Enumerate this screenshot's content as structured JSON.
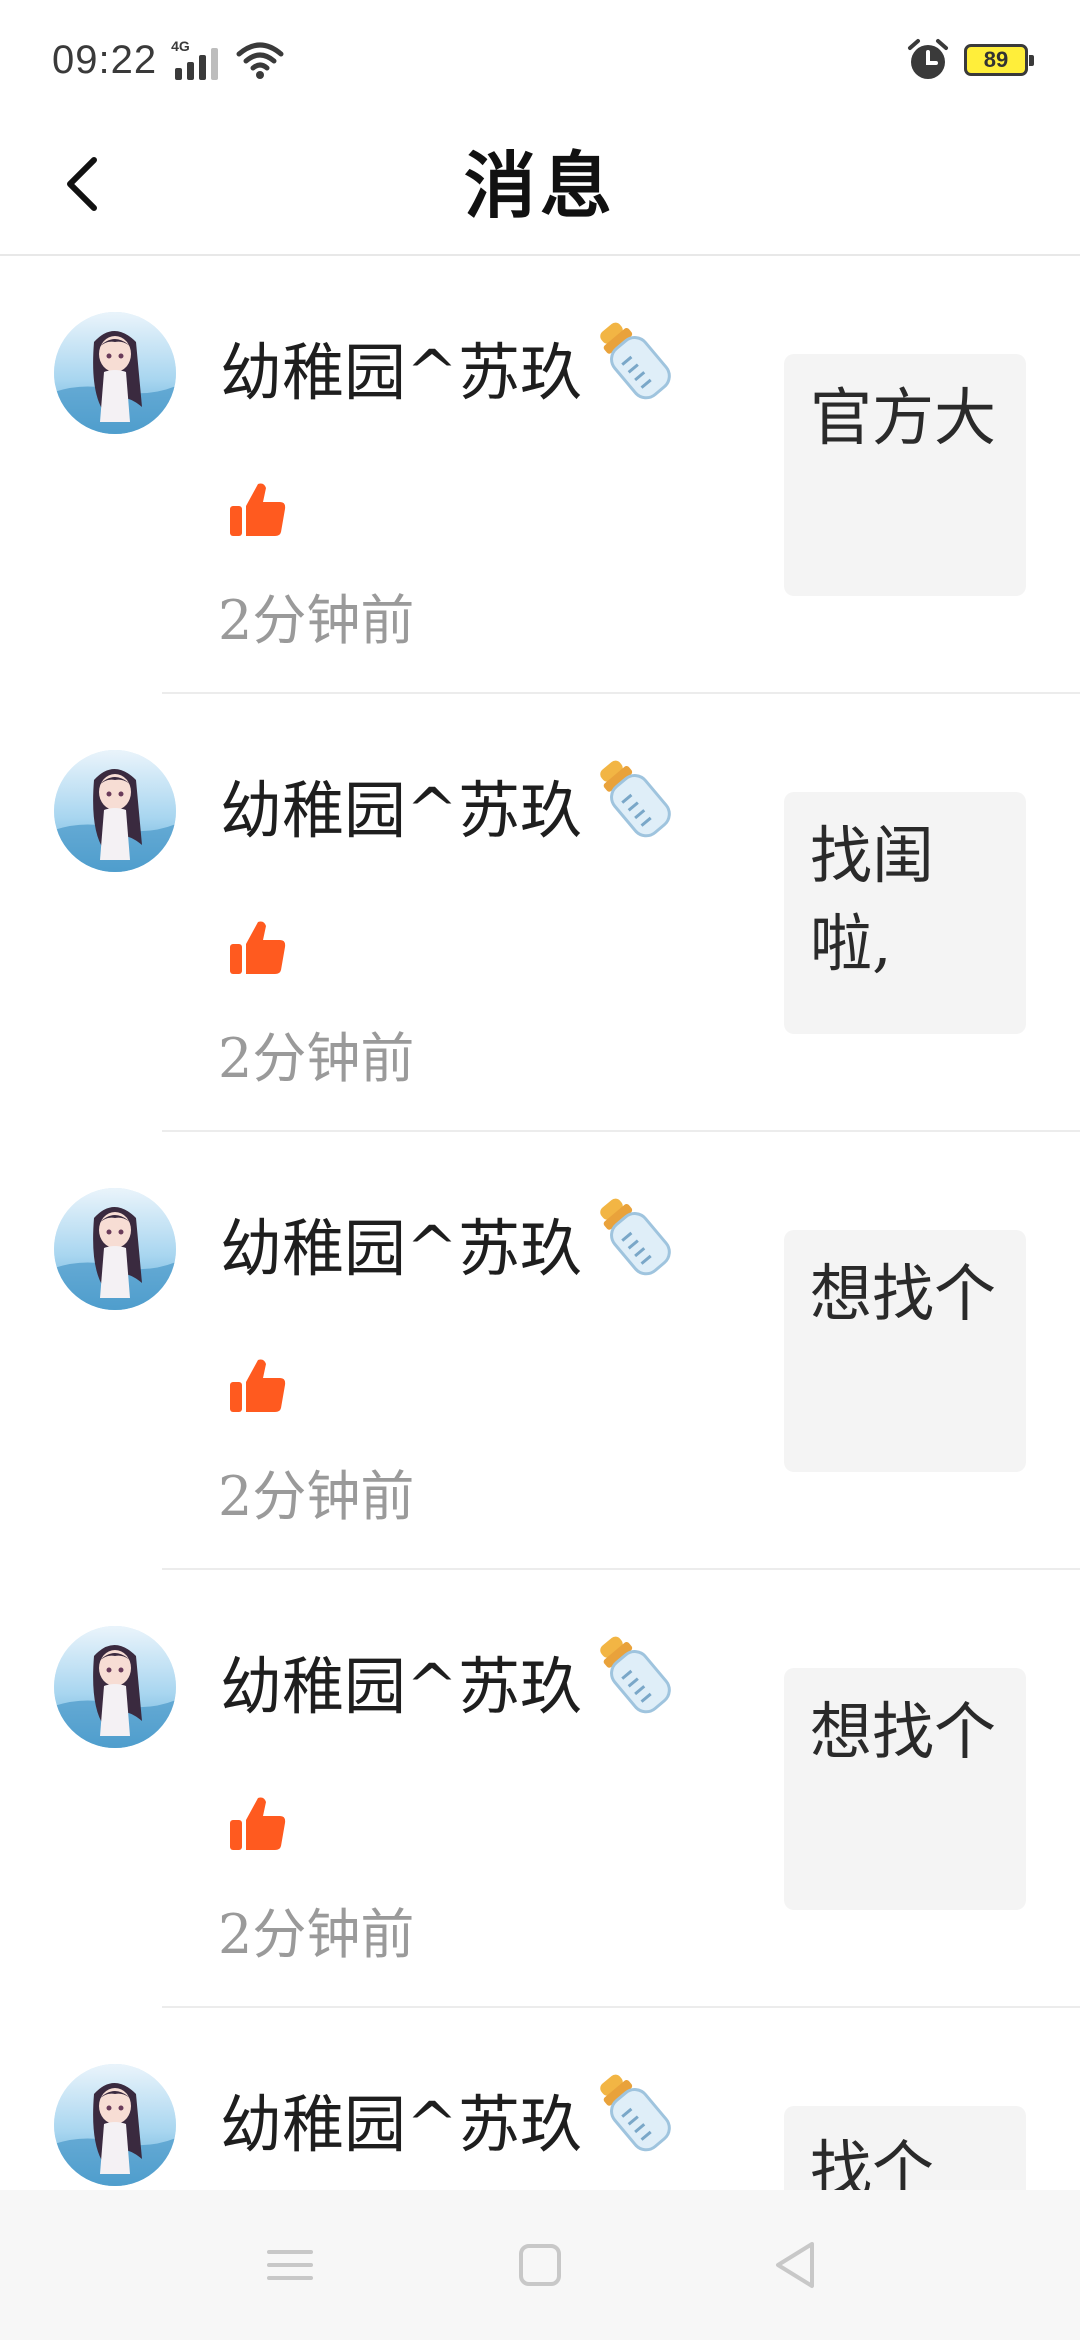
{
  "status_bar": {
    "time": "09:22",
    "network": "4G",
    "battery": "89",
    "icons": [
      "signal-icon",
      "wifi-icon",
      "alarm-icon",
      "battery-icon"
    ]
  },
  "header": {
    "title": "消息",
    "back_icon": "chevron-left-icon"
  },
  "messages": [
    {
      "username": "幼稚园^苏玖",
      "time": "2分钟前",
      "preview": "官方大"
    },
    {
      "username": "幼稚园^苏玖",
      "time": "2分钟前",
      "preview": "找闺啦,"
    },
    {
      "username": "幼稚园^苏玖",
      "time": "2分钟前",
      "preview": "想找个"
    },
    {
      "username": "幼稚园^苏玖",
      "time": "2分钟前",
      "preview": "想找个"
    },
    {
      "username": "幼稚园^苏玖",
      "time": "",
      "preview": "找个"
    }
  ],
  "colors": {
    "like": "#ff5a1f",
    "time_text": "#9a9a9a",
    "preview_bg": "#f4f4f4",
    "battery_fill": "#ffee3a"
  },
  "nav_bar": {
    "icons": [
      "menu-icon",
      "home-square-icon",
      "back-triangle-icon"
    ]
  }
}
